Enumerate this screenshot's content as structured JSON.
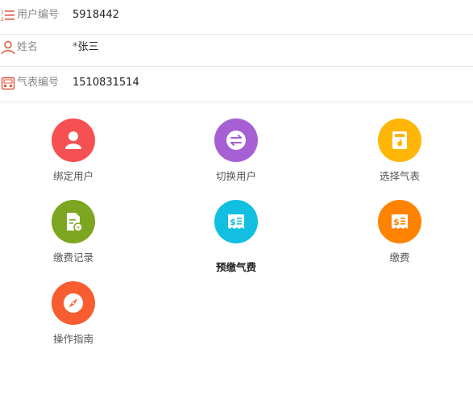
{
  "info_rows": [
    {
      "label": "用户编号",
      "value": "5918442",
      "icon": "list-number-icon"
    },
    {
      "label": "姓名",
      "required_mark": "*",
      "value": "张三",
      "icon": "person-outline-icon"
    },
    {
      "label": "气表编号",
      "value": "1510831514",
      "icon": "meter-box-icon"
    }
  ],
  "menu": [
    {
      "label": "绑定用户",
      "icon": "user-silhouette-icon",
      "color": "#f65052"
    },
    {
      "label": "切换用户",
      "icon": "swap-arrows-icon",
      "color": "#a660d4"
    },
    {
      "label": "选择气表",
      "icon": "gas-meter-icon",
      "color": "#ffb607"
    },
    {
      "label": "缴费记录",
      "icon": "payment-record-doc-icon",
      "color": "#7ca620"
    },
    {
      "label": "预缴气费",
      "icon": "dollar-receipt-icon",
      "color": "#13bfe0"
    },
    {
      "label": "缴费",
      "icon": "dollar-receipt-icon",
      "color": "#ff8200"
    },
    {
      "label": "操作指南",
      "icon": "compass-icon",
      "color": "#f85d31"
    }
  ],
  "accent_color": "#e0553b"
}
